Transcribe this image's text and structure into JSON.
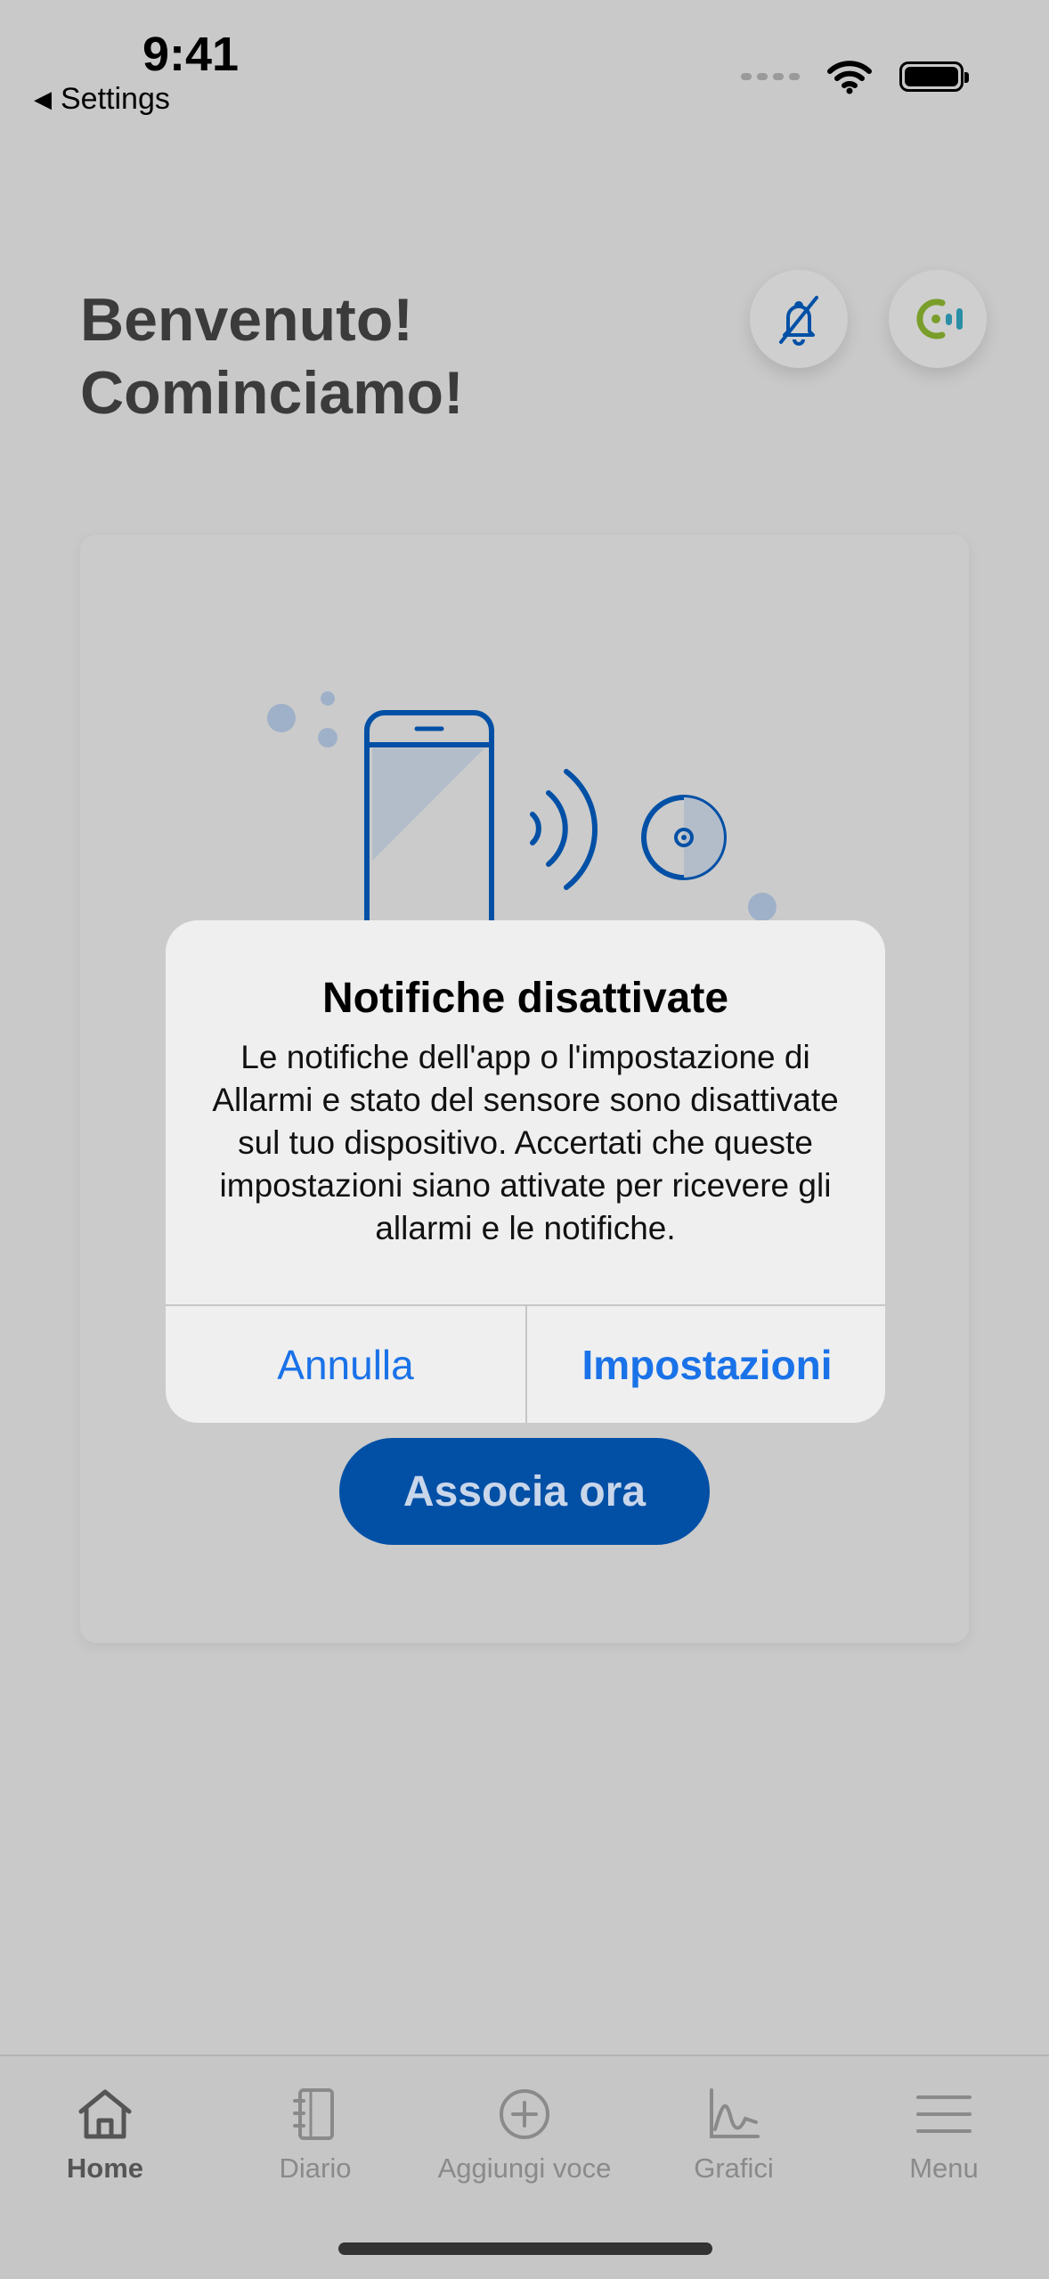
{
  "status_bar": {
    "time": "9:41",
    "back_label": "Settings"
  },
  "header": {
    "welcome_line1": "Benvenuto!",
    "welcome_line2": "Cominciamo!",
    "icons": [
      "bell-off-icon",
      "sensor-app-icon"
    ]
  },
  "card": {
    "pair_button": "Associa ora"
  },
  "alert": {
    "title": "Notifiche disattivate",
    "message": "Le notifiche dell'app o l'impostazione di Allarmi e stato del sensore sono disattivate sul tuo dispositivo. Accertati che queste impostazioni siano attivate per ricevere gli allarmi e le notifiche.",
    "cancel": "Annulla",
    "settings": "Impostazioni"
  },
  "tabbar": {
    "items": [
      {
        "label": "Home",
        "icon": "home-icon",
        "active": true
      },
      {
        "label": "Diario",
        "icon": "logbook-icon",
        "active": false
      },
      {
        "label": "Aggiungi voce",
        "icon": "add-circle-icon",
        "active": false
      },
      {
        "label": "Grafici",
        "icon": "chart-icon",
        "active": false
      },
      {
        "label": "Menu",
        "icon": "menu-icon",
        "active": false
      }
    ]
  },
  "colors": {
    "accent": "#0250a6",
    "link": "#1a72e8",
    "background": "#c9c9c9",
    "sensor_green": "#7a9e2a",
    "sensor_teal": "#2a8fa6"
  }
}
